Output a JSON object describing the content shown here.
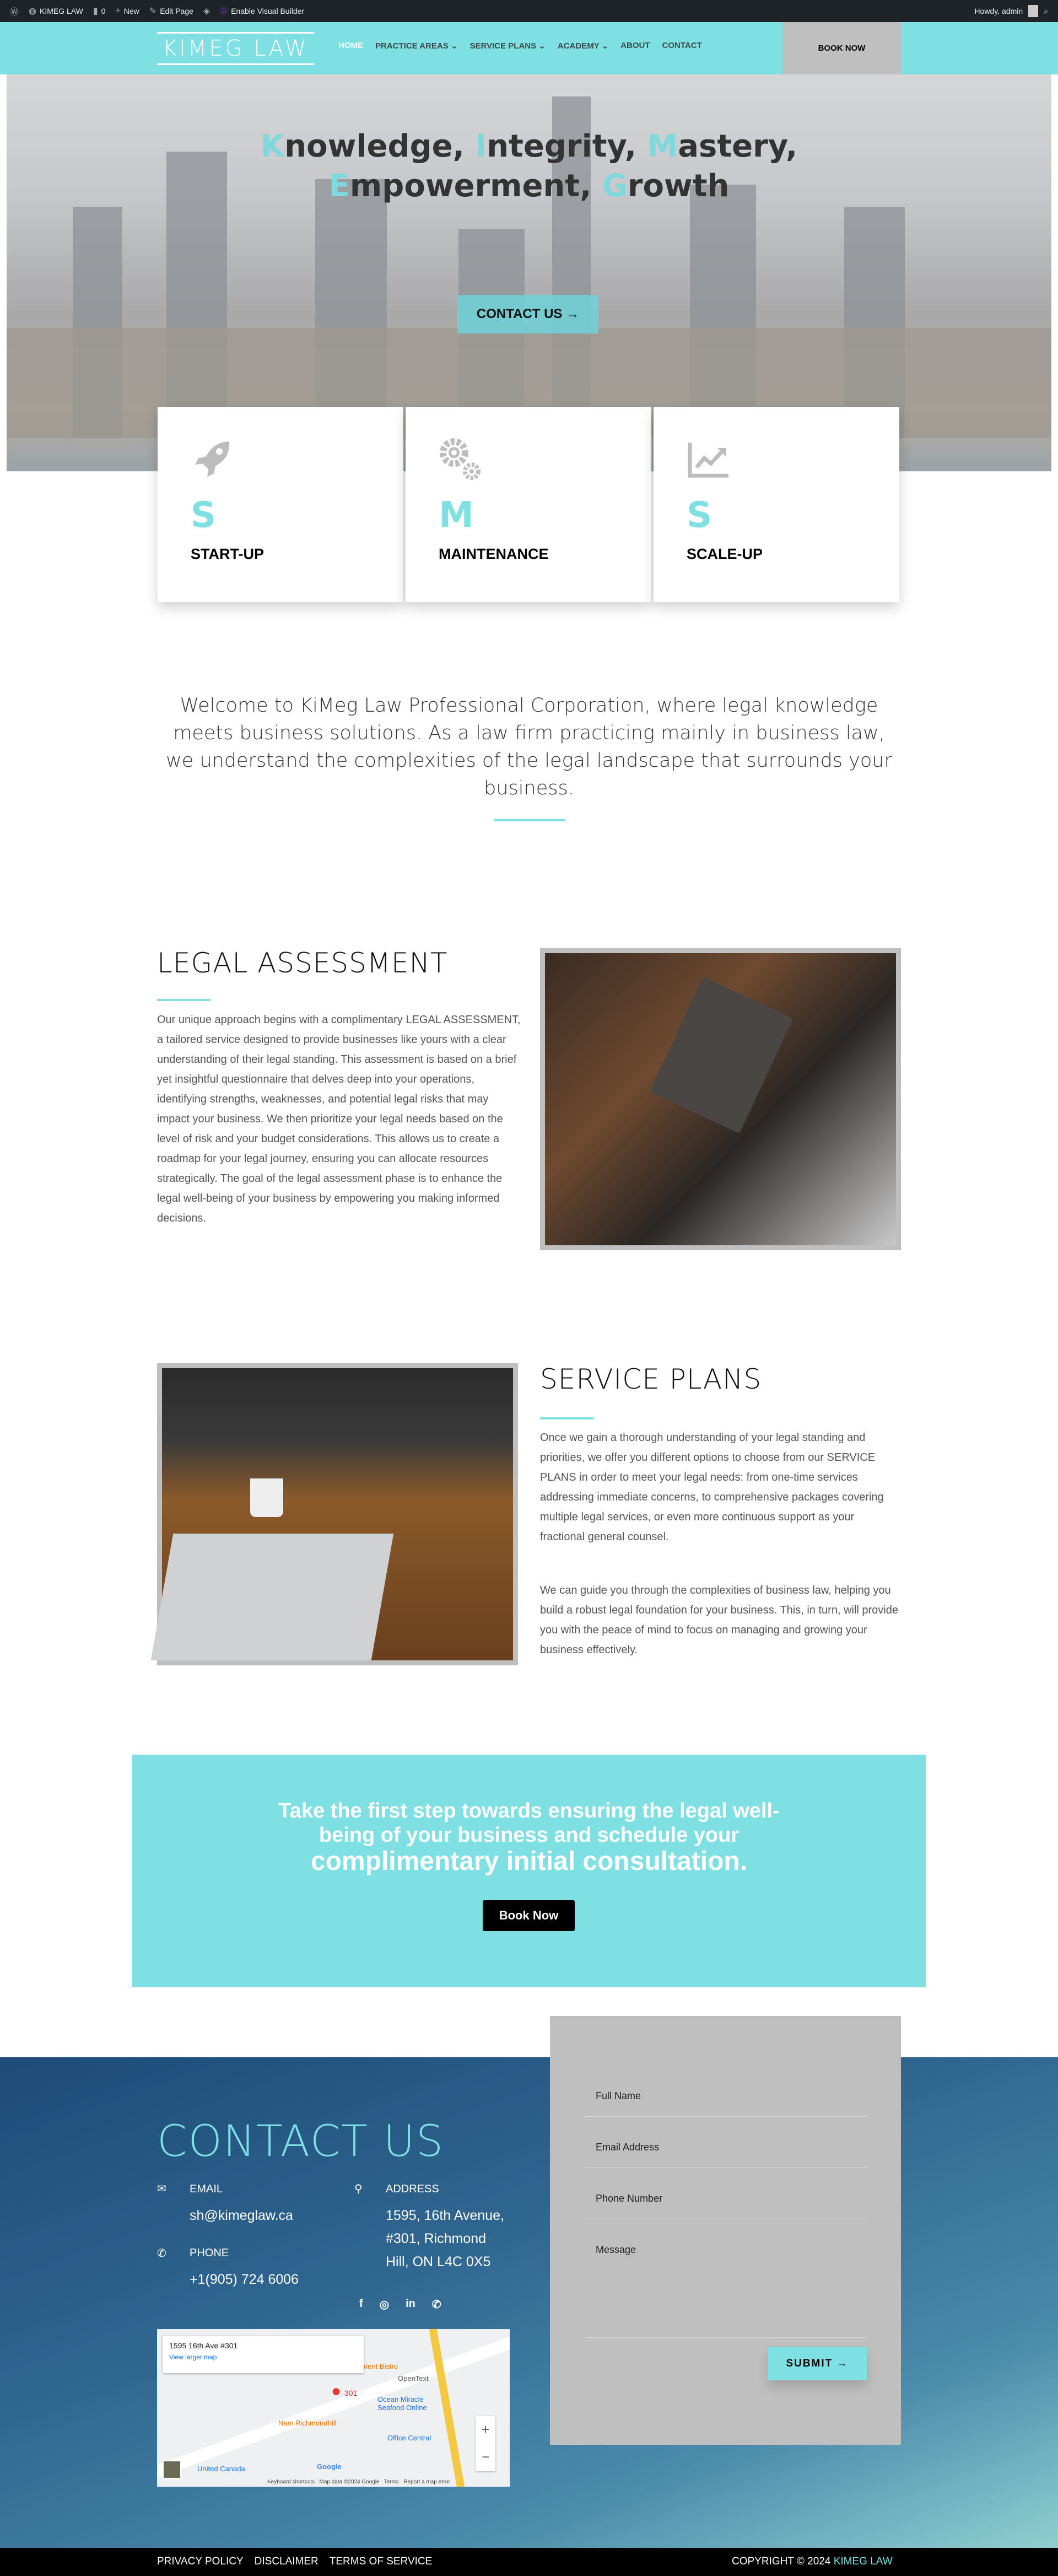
{
  "admin_bar": {
    "site": "KIMEG LAW",
    "comments": "0",
    "new": "New",
    "edit": "Edit Page",
    "builder": "Enable Visual Builder",
    "greeting": "Howdy, admin"
  },
  "header": {
    "logo": "KIMEG LAW",
    "nav": [
      {
        "label": "HOME"
      },
      {
        "label": "PRACTICE AREAS ⌄"
      },
      {
        "label": "SERVICE PLANS ⌄"
      },
      {
        "label": "ACADEMY ⌄"
      },
      {
        "label": "ABOUT"
      },
      {
        "label": "CONTACT"
      }
    ],
    "book_now": "BOOK NOW"
  },
  "hero": {
    "line1": [
      {
        "cap": "K",
        "rest": "nowledge, "
      },
      {
        "cap": "I",
        "rest": "ntegrity, "
      },
      {
        "cap": "M",
        "rest": "astery,"
      }
    ],
    "line2": [
      {
        "cap": "E",
        "rest": "mpowerment, "
      },
      {
        "cap": "G",
        "rest": "rowth"
      }
    ],
    "button": "CONTACT US →"
  },
  "cards": [
    {
      "icon": "rocket-icon",
      "letter": "S",
      "label": "START-UP"
    },
    {
      "icon": "gears-icon",
      "letter": "M",
      "label": "MAINTENANCE"
    },
    {
      "icon": "chart-growth-icon",
      "letter": "S",
      "label": "SCALE-UP"
    }
  ],
  "welcome": "Welcome to KiMeg Law Professional Corporation, where legal knowledge meets business solutions. As a law firm practicing mainly in business law, we understand the complexities of the legal landscape that surrounds your business.",
  "legal_assessment": {
    "title": "LEGAL ASSESSMENT",
    "body": "Our unique approach begins with a complimentary LEGAL ASSESSMENT, a tailored service designed to provide businesses like yours with a clear understanding of their legal standing. This assessment is based on a brief yet insightful questionnaire that delves deep into your operations, identifying strengths, weaknesses, and potential legal risks that may impact your business. We then prioritize your legal needs based on the level of risk and your budget considerations. This allows us to create a roadmap for your legal journey, ensuring you can allocate resources strategically. The goal of the legal assessment phase is to enhance the legal well-being of your business by empowering you making informed decisions."
  },
  "service_plans": {
    "title": "SERVICE PLANS",
    "body1": "Once we gain a thorough understanding of your legal standing and priorities, we offer you different options to choose from our SERVICE PLANS in order to meet your legal needs: from one-time services addressing immediate concerns, to comprehensive packages covering multiple legal services, or even more continuous support as your fractional general counsel.",
    "body2": "We can guide you through the complexities of business law, helping you build a robust legal foundation for your business. This, in turn, will provide you with the peace of mind to focus on managing and growing your business effectively."
  },
  "cta": {
    "line1": "Take the first step towards ensuring the legal well-being of your business and schedule your",
    "line2": "complimentary initial consultation.",
    "button": "Book Now"
  },
  "contact": {
    "title": "CONTACT US",
    "email_label": "EMAIL",
    "email": "sh@kimeglaw.ca",
    "phone_label": "PHONE",
    "phone": "+1(905) 724 6006",
    "address_label": "ADDRESS",
    "address": [
      "1595, 16th Avenue,",
      "#301, Richmond",
      "Hill, ON L4C 0X5"
    ],
    "social": [
      "facebook-icon",
      "instagram-icon",
      "linkedin-icon",
      "whatsapp-icon"
    ]
  },
  "map": {
    "place": "1595 16th Ave #301",
    "larger": "View larger map",
    "pin": "301",
    "labels": [
      "rient Bistro",
      "OpenText",
      "Ocean Miracle Seafood Online",
      "Nam Richmondhill",
      "Office Central",
      "United Canada",
      "Google"
    ],
    "attribution": "Keyboard shortcuts   Map data ©2024 Google   Terms   Report a map error"
  },
  "form": {
    "full_name": "Full Name",
    "email": "Email Address",
    "phone": "Phone Number",
    "message": "Message",
    "submit": "SUBMIT →"
  },
  "footer": {
    "links": [
      "PRIVACY POLICY",
      "DISCLAIMER",
      "TERMS OF SERVICE"
    ],
    "copyright": "COPYRIGHT © 2024 ",
    "brand": "KIMEG LAW"
  },
  "colors": {
    "accent": "#7fe0e4",
    "form_bg": "#bfbfbf",
    "admin_bar": "#1d2327"
  }
}
